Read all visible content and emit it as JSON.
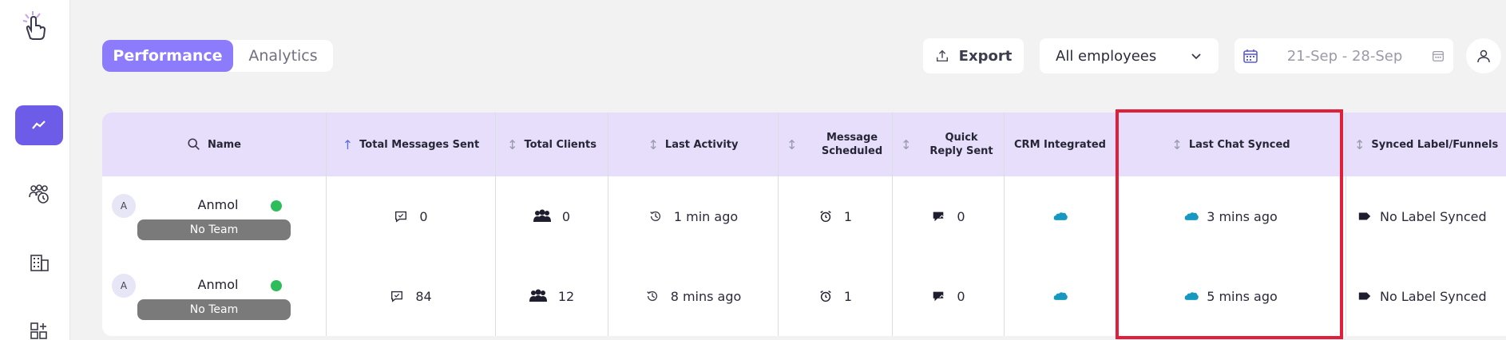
{
  "tabs": [
    {
      "label": "Performance",
      "active": true
    },
    {
      "label": "Analytics",
      "active": false
    }
  ],
  "toolbar": {
    "export_label": "Export",
    "employee_filter": "All employees",
    "date_range": "21-Sep - 28-Sep"
  },
  "table": {
    "headers": {
      "name": "Name",
      "total_messages": "Total Messages Sent",
      "total_clients": "Total Clients",
      "last_activity": "Last Activity",
      "message_scheduled": "Message Scheduled",
      "quick_reply": "Quick Reply Sent",
      "crm": "CRM Integrated",
      "last_chat": "Last Chat Synced",
      "synced_label": "Synced Label/Funnels"
    },
    "rows": [
      {
        "initial": "A",
        "name": "Anmol",
        "team": "No Team",
        "total_messages": "0",
        "total_clients": "0",
        "last_activity": "1 min ago",
        "message_scheduled": "1",
        "quick_reply": "0",
        "last_chat": "3 mins ago",
        "synced_label": "No Label Synced"
      },
      {
        "initial": "A",
        "name": "Anmol",
        "team": "No Team",
        "total_messages": "84",
        "total_clients": "12",
        "last_activity": "8 mins ago",
        "message_scheduled": "1",
        "quick_reply": "0",
        "last_chat": "5 mins ago",
        "synced_label": "No Label Synced"
      }
    ]
  },
  "colors": {
    "accent": "#8c7bfb",
    "sidebar_active": "#6c5ce7",
    "header_bg": "#e6defa",
    "online": "#2ebd5b",
    "highlight": "#e0203a",
    "salesforce": "#1798c1"
  }
}
